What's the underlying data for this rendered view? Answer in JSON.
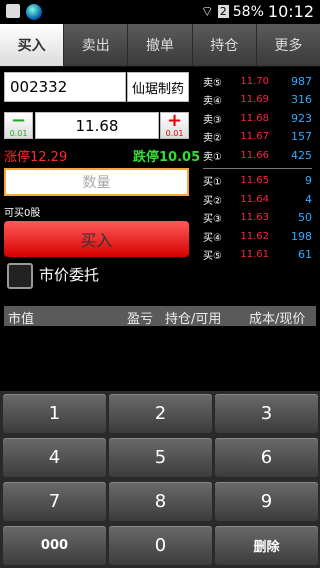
{
  "statusbar": {
    "battery": "58%",
    "time": "10:12",
    "sim": "2"
  },
  "tabs": [
    "买入",
    "卖出",
    "撤单",
    "持仓",
    "更多"
  ],
  "order": {
    "code": "002332",
    "name": "仙琚制药",
    "minus_step": "0.01",
    "plus_step": "0.01",
    "price": "11.68",
    "limit_up": "涨停12.29",
    "limit_down": "跌停10.05",
    "qty_placeholder": "数量",
    "available": "可买0股",
    "buy_label": "买入",
    "market_label": "市价委托"
  },
  "orderbook": {
    "sell": [
      {
        "label": "卖⑤",
        "price": "11.70",
        "vol": "987"
      },
      {
        "label": "卖④",
        "price": "11.69",
        "vol": "316"
      },
      {
        "label": "卖③",
        "price": "11.68",
        "vol": "923"
      },
      {
        "label": "卖②",
        "price": "11.67",
        "vol": "157"
      },
      {
        "label": "卖①",
        "price": "11.66",
        "vol": "425"
      }
    ],
    "buy": [
      {
        "label": "买①",
        "price": "11.65",
        "vol": "9"
      },
      {
        "label": "买②",
        "price": "11.64",
        "vol": "4"
      },
      {
        "label": "买③",
        "price": "11.63",
        "vol": "50"
      },
      {
        "label": "买④",
        "price": "11.62",
        "vol": "198"
      },
      {
        "label": "买⑤",
        "price": "11.61",
        "vol": "61"
      }
    ]
  },
  "positions_header": {
    "market_value": "市值",
    "pnl": "盈亏",
    "holding": "持仓/可用",
    "cost": "成本/现价"
  },
  "keypad": [
    "1",
    "2",
    "3",
    "4",
    "5",
    "6",
    "7",
    "8",
    "9",
    "000",
    "0",
    "删除"
  ],
  "colors": {
    "limit_up": "#ff2a2a",
    "limit_down": "#33dd33",
    "sell_price": "#ff2244",
    "volume": "#33aaff",
    "qty_border": "#f2a73d"
  }
}
